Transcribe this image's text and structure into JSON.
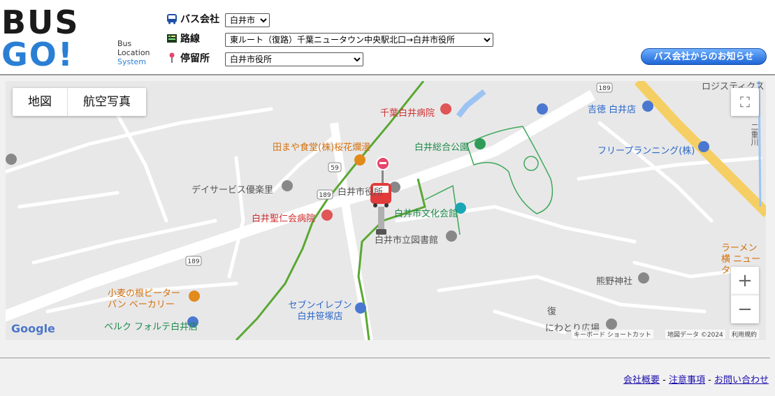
{
  "logo": {
    "text": "BUS GO!",
    "sub": [
      "Bus",
      "Location",
      "System"
    ]
  },
  "controls": {
    "company_label": "バス会社",
    "company_value": "白井市",
    "route_label": "路線",
    "route_value": "東ルート（復路）千葉ニュータウン中央駅北口→白井市役所",
    "stop_label": "停留所",
    "stop_value": "白井市役所"
  },
  "notice_button": "バス会社からのお知らせ",
  "map": {
    "type_map": "地図",
    "type_satellite": "航空写真",
    "zoom_in": "+",
    "zoom_out": "−",
    "fullscreen": "⛶",
    "google": "Google",
    "attribution": {
      "shortcuts": "キーボード ショートカット",
      "data": "地図データ ©2024",
      "terms": "利用規約"
    },
    "road_numbers": {
      "r189": "189",
      "r59": "59"
    },
    "labels": {
      "hospital1": "千葉白井病院",
      "restaurant": "田まや食堂(株)桜花爛漫",
      "park": "白井総合公園",
      "day_service": "デイサービス優楽里",
      "city_hall": "白井市役所",
      "hospital2": "白井聖仁会病院",
      "culture_hall": "白井市文化会館",
      "library": "白井市立図書館",
      "bakery": "小麦の根ピーター パン ベーカリー",
      "seven": "セブンイレブン 白井笹塚店",
      "belk": "ベルク フォルテ白井店",
      "yoshitoku": "吉徳 白井店",
      "free_planning": "フリープランニング(株)",
      "logistics": "ロジスティクス",
      "ramen": "ラーメン横 ニュータ",
      "kumano": "熊野神社",
      "niwatori": "にわとり広場",
      "fuku": "復",
      "river": "二重川"
    }
  },
  "footer": {
    "company": "会社概要",
    "notes": "注意事項",
    "contact": "お問い合わせ",
    "sep": "-"
  }
}
